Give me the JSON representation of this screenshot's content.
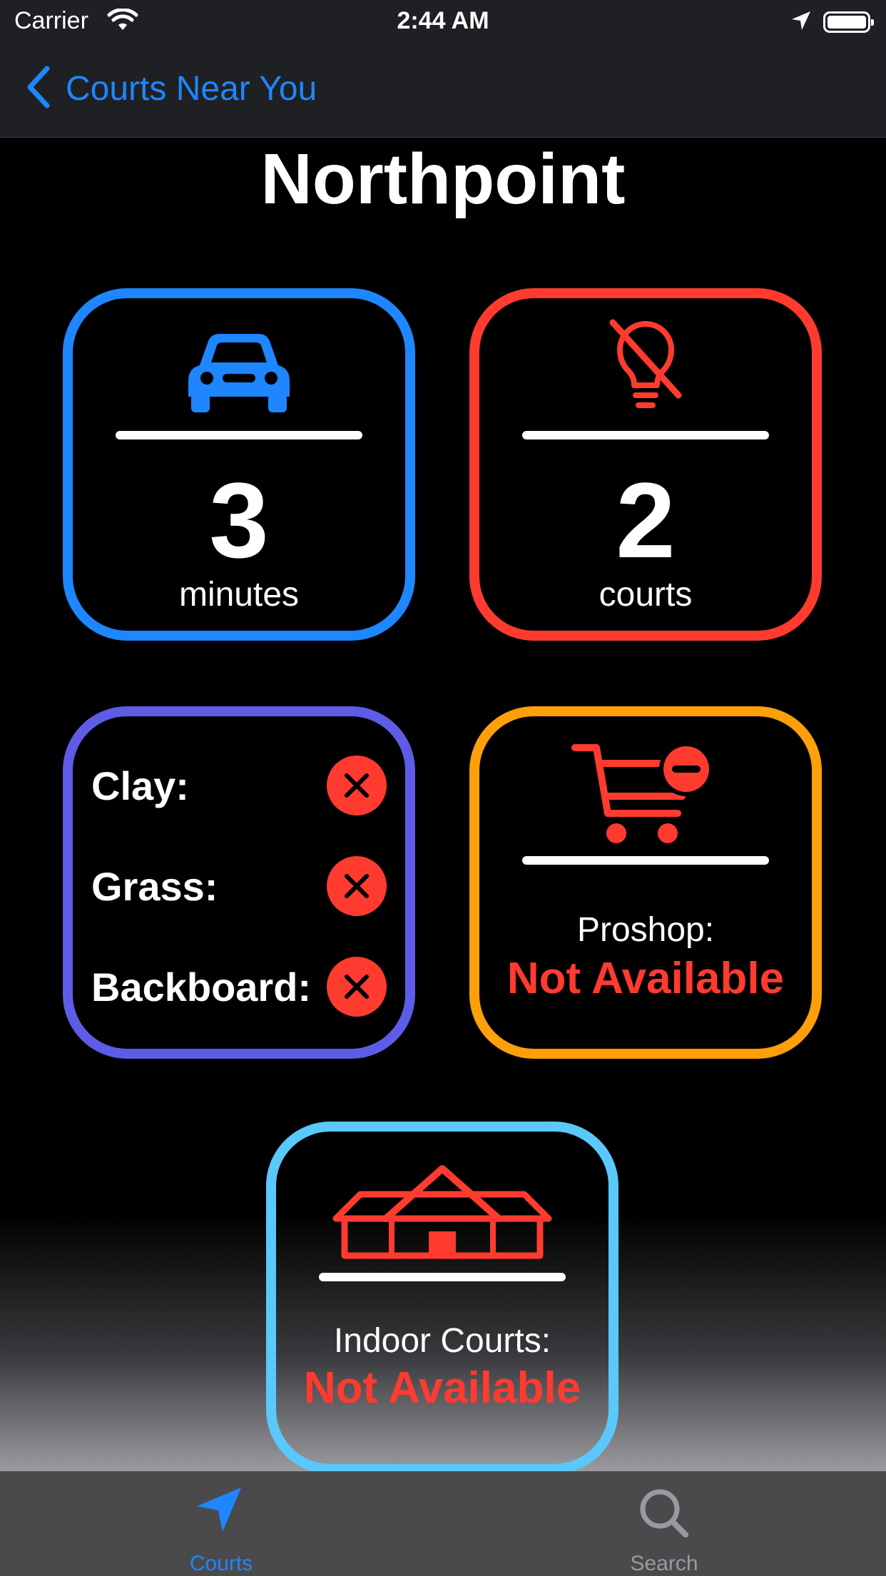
{
  "status": {
    "carrier": "Carrier",
    "time": "2:44 AM"
  },
  "nav": {
    "back_label": "Courts Near You"
  },
  "court": {
    "name": "Northpoint"
  },
  "drive": {
    "value": "3",
    "unit": "minutes",
    "color": "#1e86ff",
    "icon": "car-icon"
  },
  "courts": {
    "value": "2",
    "unit": "courts",
    "color": "#ff3b30",
    "icon": "lightbulb-slash-icon"
  },
  "surfaces": {
    "color": "#5e5ce6",
    "items": [
      {
        "label": "Clay:",
        "available": false
      },
      {
        "label": "Grass:",
        "available": false
      },
      {
        "label": "Backboard:",
        "available": false
      }
    ]
  },
  "proshop": {
    "label": "Proshop:",
    "status": "Not Available",
    "color": "#ff9f0a",
    "icon": "cart-minus-icon"
  },
  "indoor": {
    "label": "Indoor Courts:",
    "status": "Not Available",
    "color": "#5ac8fa",
    "icon": "house-icon"
  },
  "tabs": [
    {
      "label": "Courts",
      "icon": "location-arrow-icon",
      "selected": true,
      "color": "#1e86ff"
    },
    {
      "label": "Search",
      "icon": "search-icon",
      "selected": false,
      "color": "#9a9a9e"
    }
  ]
}
